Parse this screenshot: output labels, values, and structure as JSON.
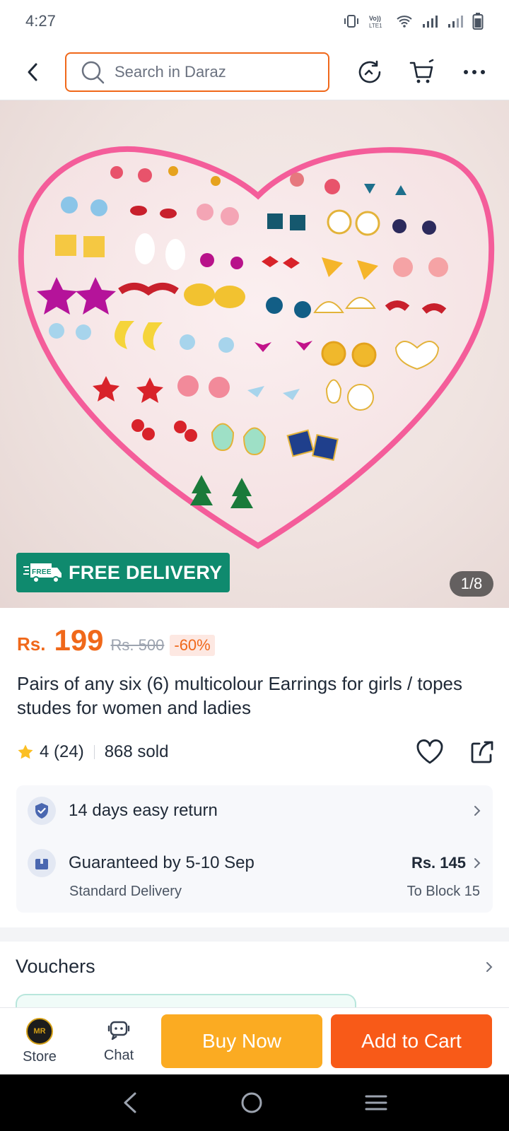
{
  "status_bar": {
    "time": "4:27",
    "volte_label": "Vo)) LTE1",
    "icons": [
      "vibrate-icon",
      "volte-icon",
      "wifi-icon",
      "signal-icon",
      "signal-icon",
      "battery-icon"
    ]
  },
  "top_nav": {
    "search_placeholder": "Search in Daraz",
    "icons": [
      "back-icon",
      "search-icon",
      "history-icon",
      "cart-icon",
      "more-icon"
    ]
  },
  "gallery": {
    "badge_label": "FREE DELIVERY",
    "badge_truck_text": "FREE",
    "counter": "1/8",
    "badge_color": "#0f8a6e"
  },
  "price": {
    "currency": "Rs.",
    "current": "199",
    "original": "Rs. 500",
    "discount": "-60%",
    "accent_color": "#f0681a"
  },
  "product": {
    "title": "Pairs of any six (6) multicolour Earrings for girls / topes studes for women and ladies",
    "rating": "4 (24)",
    "sold": "868 sold"
  },
  "info": {
    "return_policy": "14 days easy return",
    "delivery_guarantee": "Guaranteed by 5-10 Sep",
    "delivery_type": "Standard Delivery",
    "delivery_fee": "Rs. 145",
    "delivery_location": "To Block 15"
  },
  "vouchers": {
    "label": "Vouchers"
  },
  "bottom_bar": {
    "store_label": "Store",
    "store_logo_text": "MR",
    "chat_label": "Chat",
    "buy_now": "Buy Now",
    "add_to_cart": "Add to Cart",
    "buy_color": "#fbab22",
    "cart_color": "#f85a18"
  }
}
